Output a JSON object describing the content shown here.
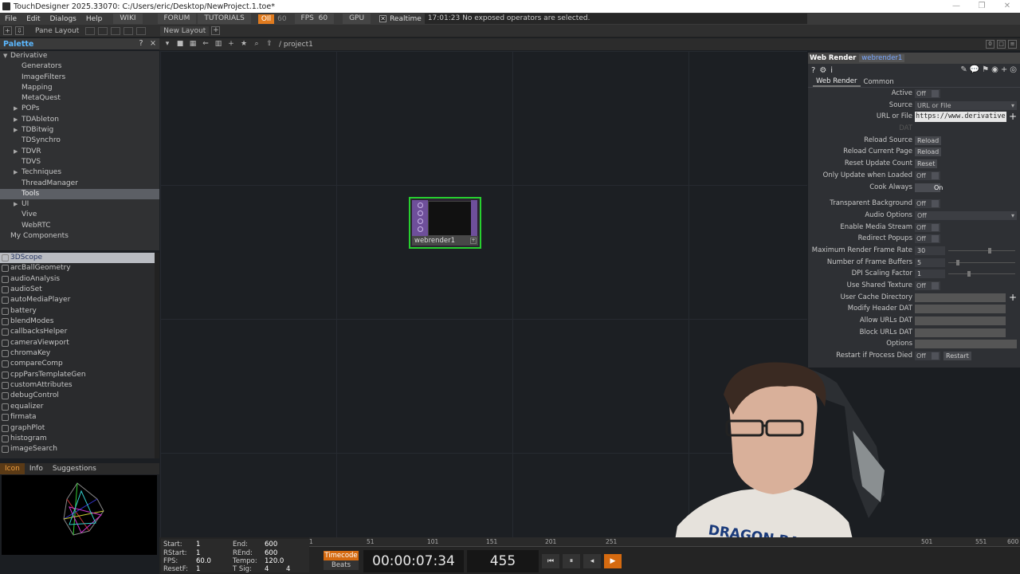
{
  "window": {
    "title": "TouchDesigner 2025.33070: C:/Users/eric/Desktop/NewProject.1.toe*",
    "controls": [
      "—",
      "❐",
      "✕"
    ]
  },
  "menubar": {
    "items": [
      "File",
      "Edit",
      "Dialogs",
      "Help"
    ],
    "wiki": "WIKI",
    "forum": "FORUM",
    "tutorials": "TUTORIALS",
    "oil": "OIl",
    "oil_value": "60",
    "fps_label": "FPS",
    "fps_value": "60",
    "gpu": "GPU",
    "realtime": "Realtime",
    "status": "17:01:23 No exposed operators are selected."
  },
  "panebar": {
    "pane_layout": "Pane Layout",
    "new_layout": "New Layout"
  },
  "palette": {
    "title": "Palette",
    "help": "?",
    "close": "×",
    "tree": [
      {
        "label": "Derivative",
        "level": 0,
        "expanded": true
      },
      {
        "label": "Generators",
        "level": 1
      },
      {
        "label": "ImageFilters",
        "level": 1
      },
      {
        "label": "Mapping",
        "level": 1
      },
      {
        "label": "MetaQuest",
        "level": 1
      },
      {
        "label": "POPs",
        "level": 1,
        "collapsed": true
      },
      {
        "label": "TDAbleton",
        "level": 1,
        "collapsed": true
      },
      {
        "label": "TDBitwig",
        "level": 1,
        "collapsed": true
      },
      {
        "label": "TDSynchro",
        "level": 1
      },
      {
        "label": "TDVR",
        "level": 1,
        "collapsed": true
      },
      {
        "label": "TDVS",
        "level": 1
      },
      {
        "label": "Techniques",
        "level": 1,
        "collapsed": true
      },
      {
        "label": "ThreadManager",
        "level": 1
      },
      {
        "label": "Tools",
        "level": 1,
        "selected": true
      },
      {
        "label": "UI",
        "level": 1,
        "collapsed": true
      },
      {
        "label": "Vive",
        "level": 1
      },
      {
        "label": "WebRTC",
        "level": 1
      },
      {
        "label": "My Components",
        "level": 0
      }
    ],
    "components": [
      "3DScope",
      "arcBallGeometry",
      "audioAnalysis",
      "audioSet",
      "autoMediaPlayer",
      "battery",
      "blendModes",
      "callbacksHelper",
      "cameraViewport",
      "chromaKey",
      "compareComp",
      "cppParsTemplateGen",
      "customAttributes",
      "debugControl",
      "equalizer",
      "firmata",
      "graphPlot",
      "histogram",
      "imageSearch"
    ],
    "info_tabs": [
      "Icon",
      "Info",
      "Suggestions"
    ]
  },
  "network": {
    "path": "/ project1",
    "node_name": "webrender1"
  },
  "params": {
    "op_type": "Web Render",
    "op_name": "webrender1",
    "tabs": [
      "Web Render",
      "Common"
    ],
    "rows": {
      "active": {
        "label": "Active",
        "value": "Off"
      },
      "source": {
        "label": "Source",
        "value": "URL or File"
      },
      "url": {
        "label": "URL or File",
        "value": "https://www.derivative.ca"
      },
      "dat": {
        "label": "DAT"
      },
      "reload_source": {
        "label": "Reload Source",
        "button": "Reload"
      },
      "reload_page": {
        "label": "Reload Current Page",
        "button": "Reload"
      },
      "reset_count": {
        "label": "Reset Update Count",
        "button": "Reset"
      },
      "only_update": {
        "label": "Only Update when Loaded",
        "value": "Off"
      },
      "cook_always": {
        "label": "Cook Always",
        "value": "On"
      },
      "transparent": {
        "label": "Transparent Background",
        "value": "Off"
      },
      "audio": {
        "label": "Audio Options",
        "value": "Off"
      },
      "media_stream": {
        "label": "Enable Media Stream",
        "value": "Off"
      },
      "popups": {
        "label": "Redirect Popups",
        "value": "Off"
      },
      "max_rate": {
        "label": "Maximum Render Frame Rate",
        "value": "30"
      },
      "frame_buffers": {
        "label": "Number of Frame Buffers",
        "value": "5"
      },
      "dpi": {
        "label": "DPI Scaling Factor",
        "value": "1"
      },
      "shared_tex": {
        "label": "Use Shared Texture",
        "value": "Off"
      },
      "cache_dir": {
        "label": "User Cache Directory"
      },
      "header_dat": {
        "label": "Modify Header DAT"
      },
      "allow_urls": {
        "label": "Allow URLs DAT"
      },
      "block_urls": {
        "label": "Block URLs DAT"
      },
      "options": {
        "label": "Options"
      },
      "restart": {
        "label": "Restart if Process Died",
        "value": "Off",
        "button": "Restart"
      }
    }
  },
  "timeline": {
    "start_label": "Start:",
    "start": "1",
    "end_label": "End:",
    "end": "600",
    "rstart_label": "RStart:",
    "rstart": "1",
    "rend_label": "REnd:",
    "rend": "600",
    "fps_label": "FPS:",
    "fps": "60.0",
    "tempo_label": "Tempo:",
    "tempo": "120.0",
    "resetf_label": "ResetF:",
    "resetf": "1",
    "tsig_label": "T Sig:",
    "tsig_a": "4",
    "tsig_b": "4",
    "ruler": [
      "1",
      "51",
      "101",
      "151",
      "201",
      "251",
      "501",
      "551",
      "600"
    ],
    "mode_timecode": "Timecode",
    "mode_beats": "Beats",
    "timecode": "00:00:07:34",
    "frame": "455"
  }
}
